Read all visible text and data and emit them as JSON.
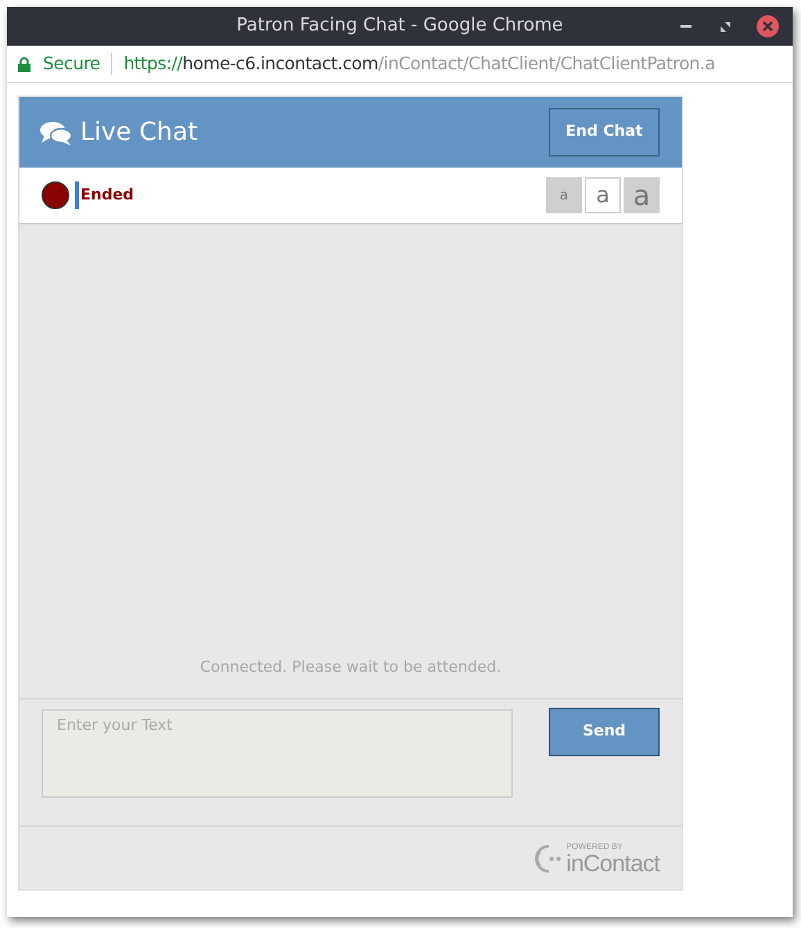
{
  "window": {
    "title": "Patron Facing Chat - Google Chrome"
  },
  "address_bar": {
    "secure_label": "Secure",
    "url_scheme": "https://",
    "url_host": "home-c6.incontact.com",
    "url_path": "/inContact/ChatClient/ChatClientPatron.a"
  },
  "header": {
    "title": "Live Chat",
    "end_button": "End Chat"
  },
  "status": {
    "label": "Ended",
    "color": "#8b0000"
  },
  "font_sizes": [
    {
      "label": "a",
      "kind": "small",
      "selected": false
    },
    {
      "label": "a",
      "kind": "medium",
      "selected": true
    },
    {
      "label": "a",
      "kind": "large",
      "selected": false
    }
  ],
  "messages": {
    "system_note": "Connected. Please wait to be attended."
  },
  "composer": {
    "placeholder": "Enter your Text",
    "send_button": "Send"
  },
  "footer": {
    "powered_by": "POWERED BY",
    "brand": "inContact"
  }
}
